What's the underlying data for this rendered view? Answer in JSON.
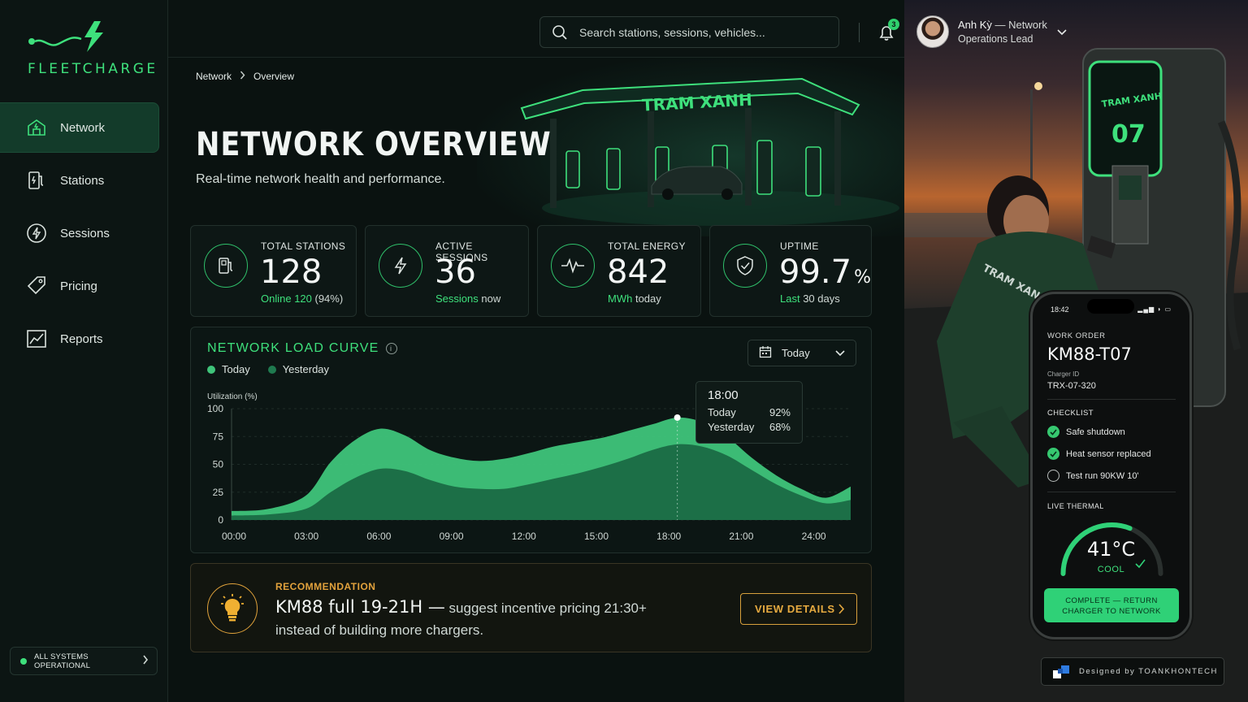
{
  "brand": {
    "name": "FLEETCHARGE",
    "accent": "#3ee07c"
  },
  "sidebar": {
    "items": [
      {
        "label": "Network",
        "icon": "network-icon",
        "active": true
      },
      {
        "label": "Stations",
        "icon": "station-icon",
        "active": false
      },
      {
        "label": "Sessions",
        "icon": "bolt-icon",
        "active": false
      },
      {
        "label": "Pricing",
        "icon": "tag-icon",
        "active": false
      },
      {
        "label": "Reports",
        "icon": "chart-icon",
        "active": false
      }
    ],
    "status": "ALL SYSTEMS OPERATIONAL"
  },
  "topbar": {
    "search_placeholder": "Search stations, sessions, vehicles...",
    "notification_count": "3"
  },
  "user": {
    "name": "Anh Kỳ",
    "dash": "— Network",
    "role": "Operations Lead"
  },
  "breadcrumb": {
    "root": "Network",
    "current": "Overview"
  },
  "hero": {
    "sign": "TRAM XANH"
  },
  "page": {
    "title": "NETWORK OVERVIEW",
    "subtitle": "Real-time network health and performance."
  },
  "kpis": [
    {
      "label": "TOTAL STATIONS",
      "value": "128",
      "unit": "",
      "sub_hl": "Online 120",
      "sub": " (94%)",
      "icon": "station-icon"
    },
    {
      "label": "ACTIVE SESSIONS",
      "value": "36",
      "unit": "",
      "sub_hl": "Sessions",
      "sub": " now",
      "icon": "bolt-icon"
    },
    {
      "label": "TOTAL ENERGY",
      "value": "842",
      "unit": "",
      "sub_hl": "MWh",
      "sub": " today",
      "icon": "pulse-icon"
    },
    {
      "label": "UPTIME",
      "value": "99.7",
      "unit": "%",
      "sub_hl": "Last",
      "sub": " 30 days",
      "icon": "shield-icon"
    }
  ],
  "chart_card": {
    "title": "NETWORK LOAD CURVE",
    "range": "Today",
    "tooltip": {
      "time": "18:00",
      "today_label": "Today",
      "today_value": "92%",
      "yesterday_label": "Yesterday",
      "yesterday_value": "68%"
    }
  },
  "chart_data": {
    "type": "area",
    "title": "NETWORK LOAD CURVE",
    "ylabel": "Utilization (%)",
    "ylim": [
      0,
      100
    ],
    "yticks": [
      0,
      25,
      50,
      75,
      100
    ],
    "xticks": [
      "00:00",
      "03:00",
      "06:00",
      "09:00",
      "12:00",
      "15:00",
      "18:00",
      "21:00",
      "24:00"
    ],
    "x": [
      0,
      1.5,
      3,
      4,
      5,
      6,
      7,
      8,
      9,
      10,
      11,
      12,
      13,
      14,
      15,
      16,
      17,
      18,
      19,
      20,
      21,
      22,
      23,
      24,
      25
    ],
    "series": [
      {
        "name": "Today",
        "color": "#3fc47a",
        "values": [
          8,
          10,
          22,
          52,
          72,
          82,
          76,
          63,
          56,
          53,
          55,
          60,
          66,
          70,
          74,
          80,
          86,
          92,
          88,
          75,
          56,
          40,
          28,
          20,
          30
        ]
      },
      {
        "name": "Yesterday",
        "color": "#1a6a45",
        "values": [
          4,
          5,
          10,
          25,
          38,
          46,
          44,
          36,
          30,
          28,
          28,
          32,
          37,
          42,
          48,
          55,
          63,
          68,
          66,
          58,
          45,
          32,
          22,
          15,
          18
        ]
      }
    ],
    "highlight_x": 18,
    "legend": "top-left",
    "grid": true
  },
  "recommendation": {
    "label": "RECOMMENDATION",
    "headline": "KM88 full 19-21H —",
    "text": " suggest incentive pricing 21:30+ instead of building more chargers.",
    "button": "VIEW DETAILS"
  },
  "phone": {
    "time": "18:42",
    "work_order_label": "WORK ORDER",
    "work_order_id": "KM88-T07",
    "charger_id_label": "Charger ID",
    "charger_id": "TRX-07-320",
    "checklist_label": "CHECKLIST",
    "checklist": [
      {
        "label": "Safe shutdown",
        "done": true
      },
      {
        "label": "Heat sensor replaced",
        "done": true
      },
      {
        "label": "Test run 90KW 10'",
        "done": false
      }
    ],
    "thermal_label": "LIVE THERMAL",
    "temperature": "41°C",
    "thermal_state": "COOL",
    "thermal_level": 0.62,
    "button_line1": "COMPLETE — RETURN",
    "button_line2": "CHARGER TO NETWORK"
  },
  "photo_sign": {
    "brand": "TRAM XANH",
    "number": "07",
    "uniform": "TRAM XANH"
  },
  "credit": "Designed by TOANKHONTECH"
}
